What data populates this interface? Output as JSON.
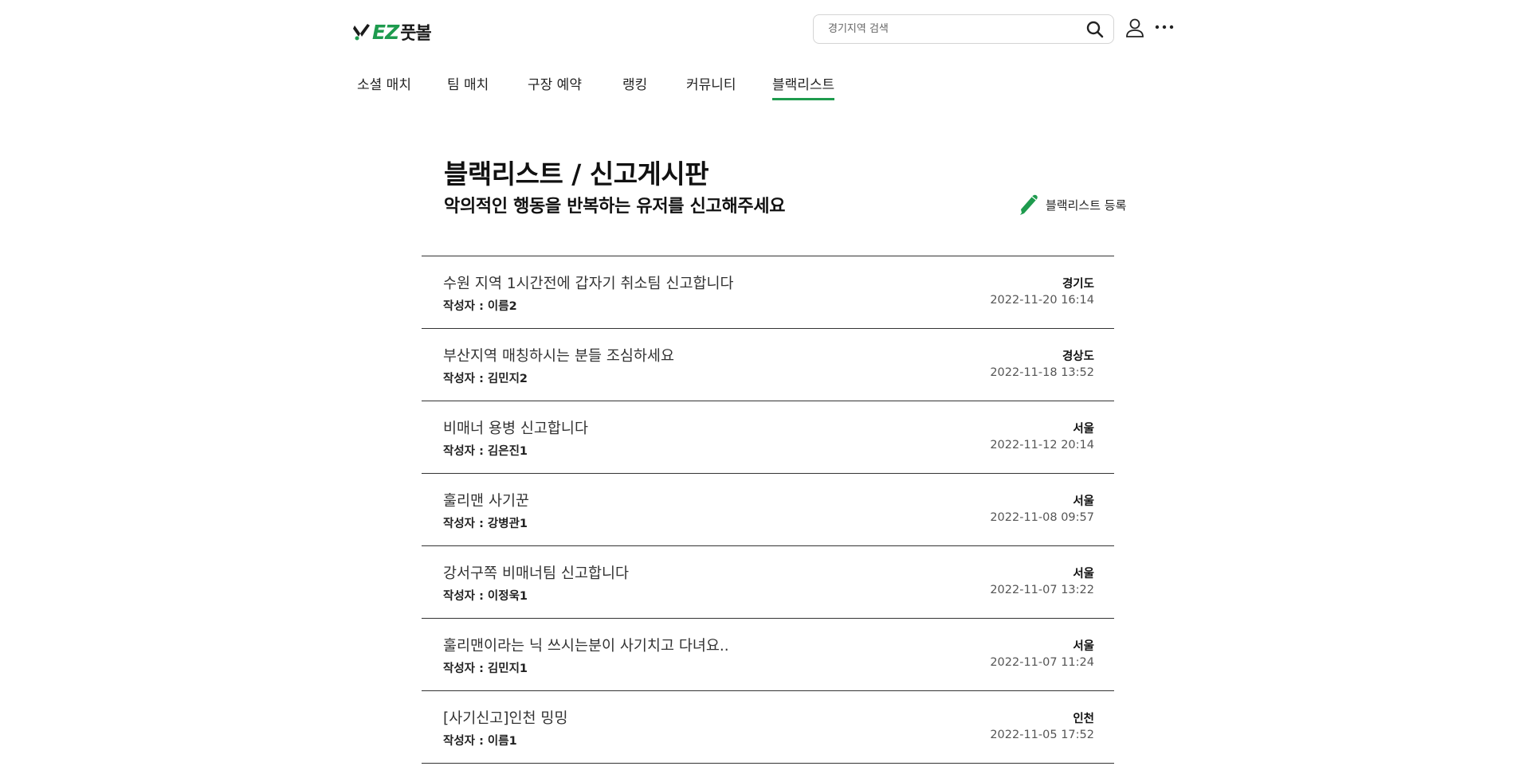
{
  "header": {
    "logo_text_en": "EZ",
    "logo_text_kr": "풋볼",
    "search": {
      "placeholder": "경기지역 검색",
      "value": ""
    }
  },
  "nav": {
    "tabs": [
      {
        "label": "소셜 매치"
      },
      {
        "label": "팀 매치"
      },
      {
        "label": "구장 예약"
      },
      {
        "label": "랭킹"
      },
      {
        "label": "커뮤니티"
      },
      {
        "label": "블랙리스트"
      }
    ],
    "active_tab": "블랙리스트"
  },
  "page": {
    "title": "블랙리스트 / 신고게시판",
    "subtitle": "악의적인 행동을 반복하는 유저를 신고해주세요",
    "register_label": "블랙리스트 등록"
  },
  "posts": [
    {
      "title": "수원 지역 1시간전에 갑자기 취소팀 신고합니다",
      "author": "작성자 : 이름2",
      "region": "경기도",
      "date": "2022-11-20 16:14"
    },
    {
      "title": "부산지역 매칭하시는 분들 조심하세요",
      "author": "작성자 : 김민지2",
      "region": "경상도",
      "date": "2022-11-18 13:52"
    },
    {
      "title": "비매너 용병 신고합니다",
      "author": "작성자 : 김은진1",
      "region": "서울",
      "date": "2022-11-12 20:14"
    },
    {
      "title": "훌리맨 사기꾼",
      "author": "작성자 : 강병관1",
      "region": "서울",
      "date": "2022-11-08 09:57"
    },
    {
      "title": "강서구쪽 비매너팀 신고합니다",
      "author": "작성자 : 이정욱1",
      "region": "서울",
      "date": "2022-11-07 13:22"
    },
    {
      "title": "훌리맨이라는 닉 쓰시는분이 사기치고 다녀요..",
      "author": "작성자 : 김민지1",
      "region": "서울",
      "date": "2022-11-07 11:24"
    },
    {
      "title": "[사기신고]인천 밍밍",
      "author": "작성자 : 이름1",
      "region": "인천",
      "date": "2022-11-05 17:52"
    }
  ],
  "colors": {
    "accent": "#1e9b4e",
    "divider": "#333333"
  },
  "icons": {
    "logo": "ez-football-logo-icon",
    "search": "search-icon",
    "user": "user-icon",
    "more": "more-icon",
    "register": "pen-icon"
  }
}
